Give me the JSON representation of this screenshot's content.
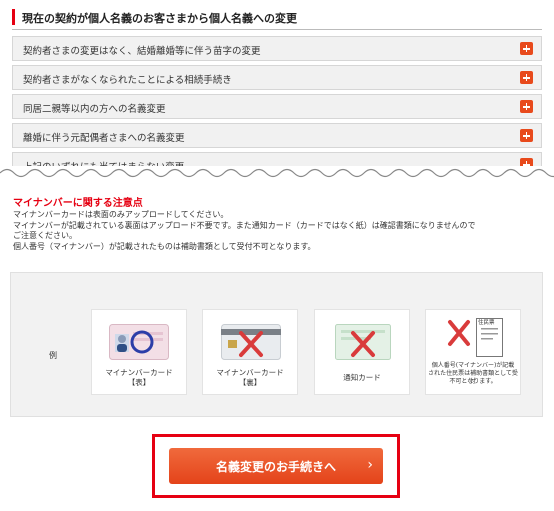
{
  "section": {
    "title": "現在の契約が個人名義のお客さまから個人名義への変更"
  },
  "accordion": {
    "items": [
      {
        "label": "契約者さまの変更はなく、結婚離婚等に伴う苗字の変更"
      },
      {
        "label": "契約者さまがなくなられたことによる相続手続き"
      },
      {
        "label": "同居二親等以内の方への名義変更"
      },
      {
        "label": "離婚に伴う元配偶者さまへの名義変更"
      },
      {
        "label": "上記のいずれにも当てはまらない変更"
      }
    ]
  },
  "notice": {
    "heading": "マイナンバーに関する注意点",
    "lines": [
      "マイナンバーカードは表面のみアップロードしてください。",
      "マイナンバーが記載されている裏面はアップロード不要です。また通知カード（カードではなく紙）は確認書類になりませんので",
      "ご注意ください。",
      "個人番号（マイナンバー）が記載されたものは補助書類として受付不可となります。"
    ]
  },
  "examples": {
    "label": "例",
    "cards": [
      {
        "caption1": "マイナンバーカード",
        "caption2": "【表】"
      },
      {
        "caption1": "マイナンバーカード",
        "caption2": "【裏】"
      },
      {
        "caption1": "通知カード",
        "caption2": ""
      },
      {
        "caption1": "個人番号(マイナンバー)が記載",
        "caption2": "された住民票は補助書類として受付",
        "caption3": "不可となります。"
      }
    ],
    "doc_title": "住民票"
  },
  "cta": {
    "label": "名義変更のお手続きへ",
    "chevron": "›"
  },
  "colors": {
    "accent_red": "#e60012",
    "button_orange": "#e84a1c"
  }
}
